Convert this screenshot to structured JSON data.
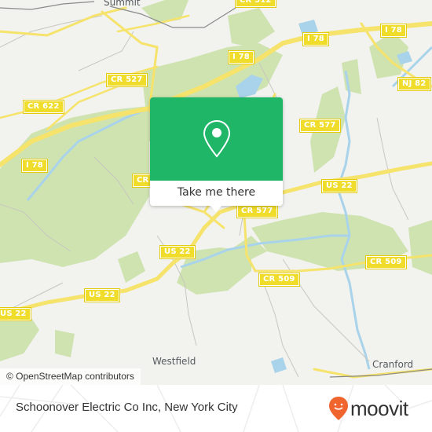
{
  "map": {
    "colors": {
      "background": "#f2f2ef",
      "park": "#cfe3b0",
      "water": "#a9d3ea",
      "road_major": "#f5e36b",
      "road_minor": "#c8c6c0",
      "rail": "#8a8a8a",
      "shield": "#f0dc2a"
    },
    "places": [
      {
        "name": "Summit"
      },
      {
        "name": "Westfield"
      },
      {
        "name": "Cranford"
      }
    ],
    "road_shields": [
      {
        "label": "CR 512"
      },
      {
        "label": "I 78"
      },
      {
        "label": "I 78"
      },
      {
        "label": "I 78"
      },
      {
        "label": "I 78"
      },
      {
        "label": "NJ 82"
      },
      {
        "label": "CR 527"
      },
      {
        "label": "CR 622"
      },
      {
        "label": "CR 577"
      },
      {
        "label": "CR"
      },
      {
        "label": "US 22"
      },
      {
        "label": "CR 577"
      },
      {
        "label": "US 22"
      },
      {
        "label": "US 22"
      },
      {
        "label": "US 22"
      },
      {
        "label": "CR 509"
      },
      {
        "label": "CR 509"
      }
    ],
    "attribution": "© OpenStreetMap contributors"
  },
  "popup": {
    "icon": "location-pin-icon",
    "button_label": "Take me there",
    "color": "#1fb767"
  },
  "footer": {
    "title": "Schoonover Electric Co Inc, New York City",
    "logo_text": "moovit",
    "logo_color": "#f0642d"
  }
}
